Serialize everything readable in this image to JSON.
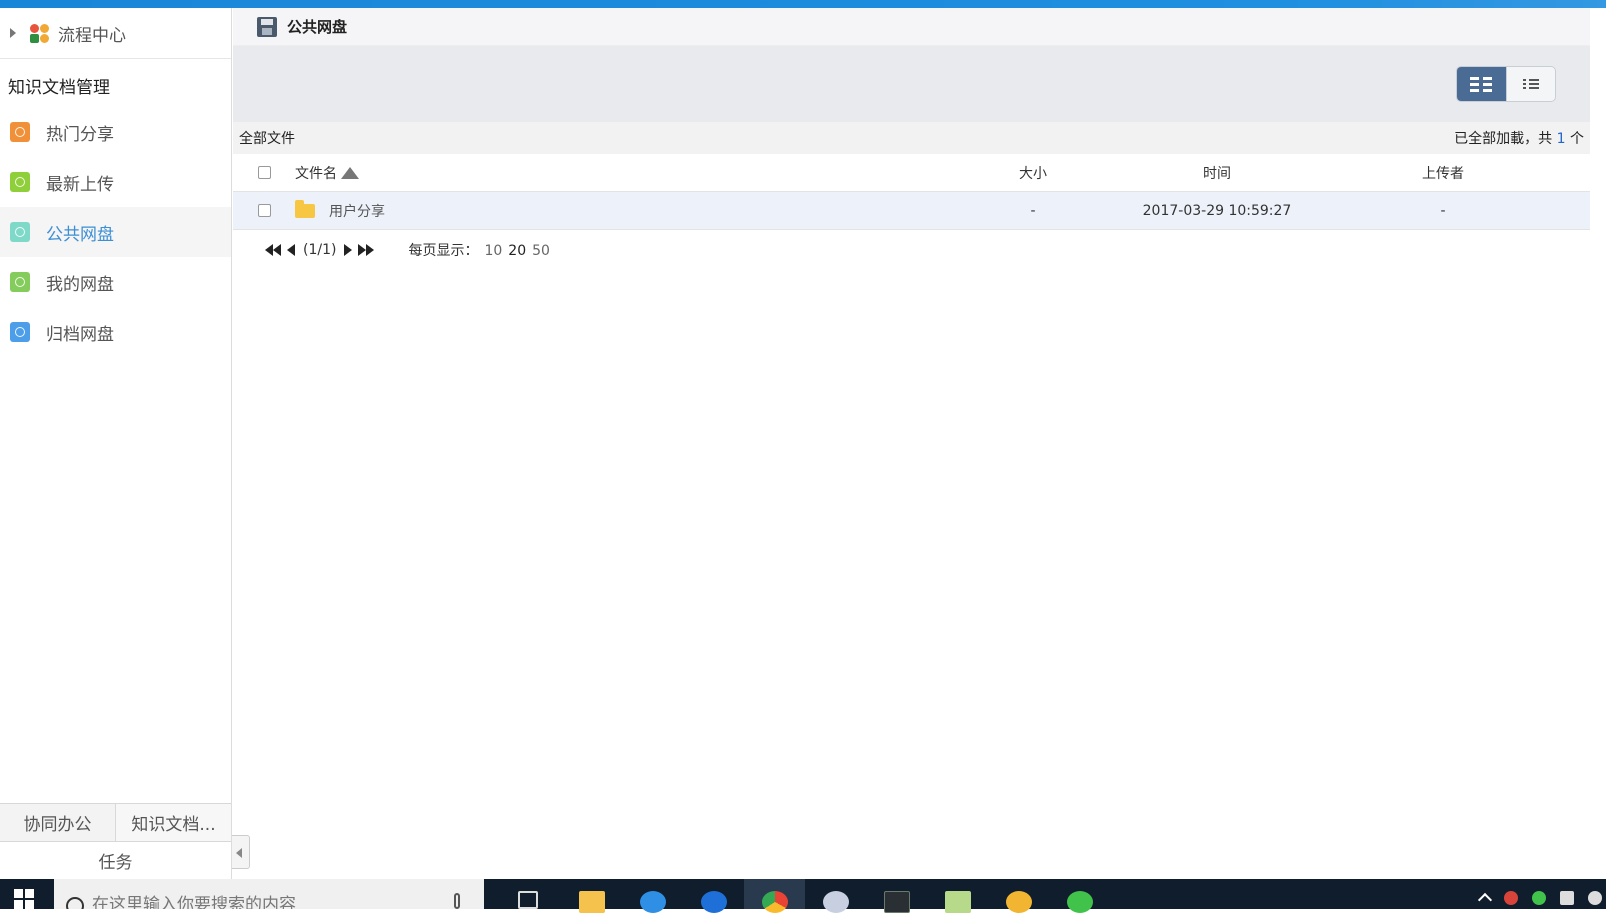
{
  "sidebar": {
    "flow_center": "流程中心",
    "section_title": "知识文档管理",
    "items": [
      {
        "label": "热门分享",
        "icon": "hot-share-icon",
        "color": "#f0913a"
      },
      {
        "label": "最新上传",
        "icon": "upload-icon",
        "color": "#8fcf3a"
      },
      {
        "label": "公共网盘",
        "icon": "public-disk-icon",
        "color": "#7fd9c9"
      },
      {
        "label": "我的网盘",
        "icon": "my-disk-icon",
        "color": "#84cc5c"
      },
      {
        "label": "归档网盘",
        "icon": "archive-disk-icon",
        "color": "#4d9ee8"
      }
    ],
    "bottom_tabs": [
      "协同办公",
      "知识文档..."
    ],
    "task_tab": "任务"
  },
  "main": {
    "title": "公共网盘",
    "summary": {
      "left": "全部文件",
      "right_prefix": "已全部加載，共",
      "count": "1",
      "right_suffix": "个"
    },
    "columns": {
      "name": "文件名",
      "size": "大小",
      "time": "时间",
      "uploader": "上传者"
    },
    "rows": [
      {
        "name": "用户分享",
        "size": "-",
        "time": "2017-03-29 10:59:27",
        "uploader": "-"
      }
    ],
    "pager": {
      "page_text": "(1/1)",
      "per_page_label": "每页显示：",
      "options": [
        "10",
        "20",
        "50"
      ]
    }
  },
  "taskbar": {
    "search_placeholder": "在这里输入你要搜索的内容"
  },
  "colors": {
    "accent": "#1f8fe0",
    "active_nav_text": "#3c8fd4",
    "view_toggle_on": "#4a6b94",
    "folder": "#f7c744"
  }
}
